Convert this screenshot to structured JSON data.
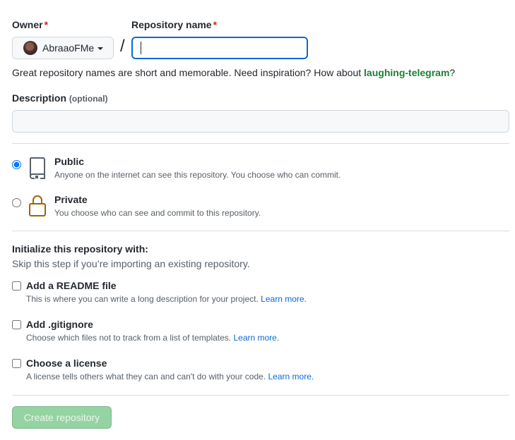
{
  "owner": {
    "label": "Owner",
    "required_mark": "*",
    "value": "AbraaoFMe"
  },
  "repo": {
    "label": "Repository name",
    "required_mark": "*",
    "separator": "/",
    "value": ""
  },
  "hint": {
    "prefix": "Great repository names are short and memorable. Need inspiration? How about ",
    "suggestion": "laughing-telegram",
    "suffix": "?"
  },
  "description": {
    "label": "Description",
    "optional": "(optional)",
    "value": ""
  },
  "visibility": {
    "selected": "public",
    "options": [
      {
        "title": "Public",
        "note": "Anyone on the internet can see this repository. You choose who can commit.",
        "icon": "repo-icon"
      },
      {
        "title": "Private",
        "note": "You choose who can see and commit to this repository.",
        "icon": "lock-icon"
      }
    ]
  },
  "init": {
    "heading": "Initialize this repository with:",
    "subheading": "Skip this step if you’re importing an existing repository.",
    "learn_more": "Learn more.",
    "options": [
      {
        "title": "Add a README file",
        "note": "This is where you can write a long description for your project.",
        "checked": false
      },
      {
        "title": "Add .gitignore",
        "note": "Choose which files not to track from a list of templates.",
        "checked": false
      },
      {
        "title": "Choose a license",
        "note": "A license tells others what they can and can't do with your code.",
        "checked": false
      }
    ]
  },
  "submit": {
    "label": "Create repository",
    "disabled": true
  },
  "colors": {
    "required": "#cf222e",
    "suggestion": "#1a7f37",
    "link": "#0969da",
    "focus": "#0969da",
    "button_disabled": "#94d3a2"
  }
}
